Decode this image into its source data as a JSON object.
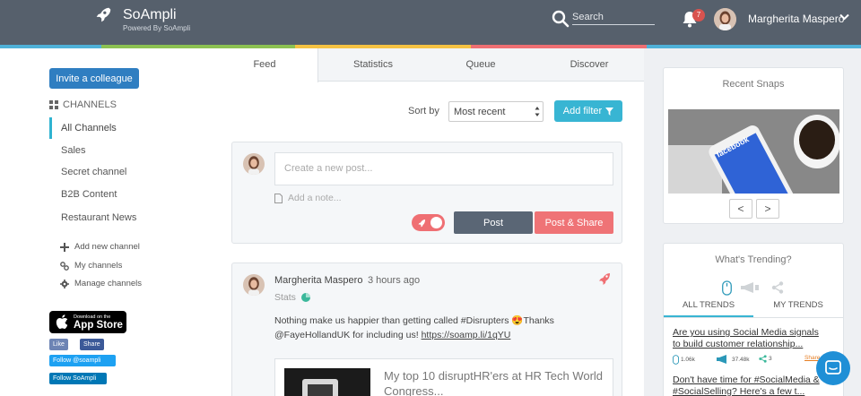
{
  "header": {
    "brand": "SoAmpli",
    "brand_sub": "Powered By SoAmpli",
    "search_placeholder": "Search",
    "notification_count": "7",
    "user_name": "Margherita Maspero",
    "stripe_colors": [
      "#4fb1d8",
      "#8cc152",
      "#f5c242",
      "#ef6f73",
      "#4fb1d8"
    ]
  },
  "sidebar": {
    "invite_label": "Invite a colleague",
    "channels_heading": "CHANNELS",
    "channels": [
      "All Channels",
      "Sales",
      "Secret channel",
      "B2B Content",
      "Restaurant News"
    ],
    "actions": [
      "Add new channel",
      "My channels",
      "Manage channels"
    ],
    "appstore_line1": "Download on the",
    "appstore_line2": "App Store",
    "social": {
      "like": "Like",
      "share": "Share",
      "twitter": "Follow @soampli",
      "linkedin": "Follow SoAmpli"
    }
  },
  "center": {
    "tabs": [
      "Feed",
      "Statistics",
      "Queue",
      "Discover"
    ],
    "sort_label": "Sort by",
    "sort_value": "Most recent",
    "filter_label": "Add filter",
    "composer": {
      "post_placeholder": "Create a new post...",
      "note_placeholder": "Add a note...",
      "post_label": "Post",
      "share_label": "Post & Share"
    },
    "post": {
      "author": "Margherita Maspero",
      "time": "3 hours ago",
      "stats_label": "Stats",
      "text": "Nothing make us happier than getting called #Disrupters 😍Thanks @FayeHollandUK for including us! ",
      "link": "https://soamp.li/1qYU",
      "preview_title": "My top 10 disruptHR'ers at HR Tech World Congress..."
    }
  },
  "right": {
    "snaps_title": "Recent Snaps",
    "prev_label": "<",
    "next_label": ">",
    "snap_brand": "facebook",
    "trending_title": "What's Trending?",
    "trend_tabs": [
      "ALL TRENDS",
      "MY TRENDS"
    ],
    "trend_items": [
      "Are you using Social Media signals to build customer relationship...",
      "Don't have time for #SocialMedia & #SocialSelling? Here's a few t..."
    ],
    "metrics": [
      "1.06k",
      "37.48k",
      "3"
    ],
    "share_label": "Share"
  },
  "colors": {
    "topbar": "#56606c",
    "accent": "#38b5d3",
    "primary": "#2f7ec1",
    "danger": "#ef7376"
  }
}
